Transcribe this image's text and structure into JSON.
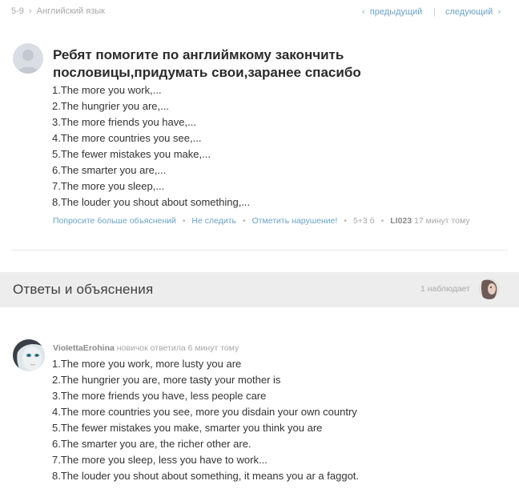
{
  "breadcrumb": {
    "grade": "5-9",
    "separator": "›",
    "subject": "Английский язык"
  },
  "nav": {
    "prev_arrow": "‹",
    "prev_label": "предыдущий",
    "separator": "|",
    "next_label": "следующий",
    "next_arrow": "›"
  },
  "question": {
    "title": "Ребят помогите по английмкому закончить пословицы,придумать свои,заранее спасибо",
    "lines": [
      "1.The more you work,...",
      "2.The hungrier you are,...",
      "3.The more friends you have,...",
      "4.The more countries you see,...",
      "5.The fewer mistakes you make,...",
      "6.The smarter you are,...",
      "7.The more you sleep,...",
      "8.The louder you shout about something,..."
    ],
    "meta": {
      "ask_more": "Попросите больше объяснений",
      "unfollow": "Не следить",
      "report": "Отметить нарушение!",
      "points": "5+3 б",
      "user": "LI023",
      "time": "17 минут тому"
    }
  },
  "answers": {
    "title": "Ответы и объяснения",
    "watchers": "1 наблюдает"
  },
  "answer": {
    "author": "VioIettaErohina",
    "header_rest": "новичок ответила 6 минут тому",
    "lines": [
      "1.The more you work, more lusty you are",
      "2.The hungrier you are, more tasty your mother is",
      "3.The more friends you have, less people care",
      "4.The more countries you see, more you disdain your own country",
      "5.The fewer mistakes you make, smarter you think you are",
      "6.The smarter you are, the richer other are.",
      "7.The more you sleep, less you have to work...",
      "8.The louder you shout about something, it means you ar a faggot."
    ]
  }
}
